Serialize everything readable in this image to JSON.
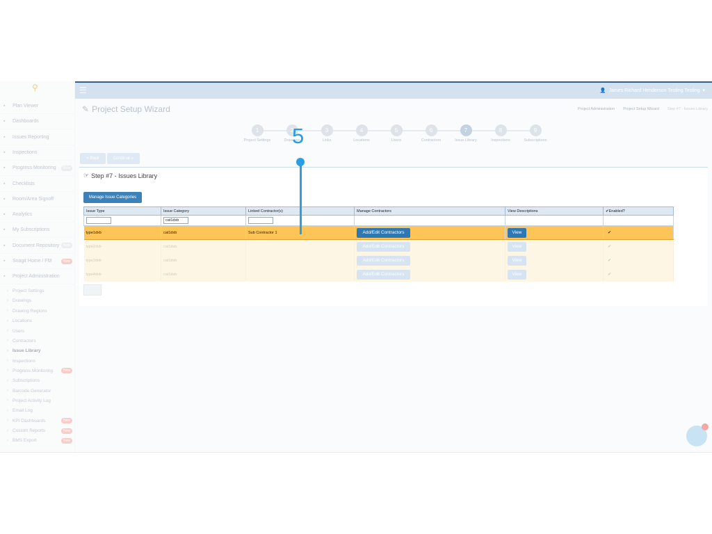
{
  "topbar": {
    "menu_icon": "hamburger-icon",
    "user_name": "James Richard Henderson Testing Testing"
  },
  "sidebar": {
    "items": [
      {
        "label": "Plan Viewer",
        "icon": "plan-icon",
        "badge": ""
      },
      {
        "label": "Dashboards",
        "icon": "dashboard-icon",
        "badge": ""
      },
      {
        "label": "Issues Reporting",
        "icon": "pin-icon",
        "badge": ""
      },
      {
        "label": "Inspections",
        "icon": "search-icon",
        "badge": ""
      },
      {
        "label": "Progress Monitoring",
        "icon": "chart-icon",
        "badge": "Beta"
      },
      {
        "label": "Checklists",
        "icon": "check-icon",
        "badge": ""
      },
      {
        "label": "Room/Area Signoff",
        "icon": "arrow-icon",
        "badge": ""
      },
      {
        "label": "Analytics",
        "icon": "analytics-icon",
        "badge": ""
      },
      {
        "label": "My Subscriptions",
        "icon": "subscription-icon",
        "badge": ""
      },
      {
        "label": "Document Repository",
        "icon": "document-icon",
        "badge": "Beta"
      },
      {
        "label": "Snagit Home / FM",
        "icon": "home-icon",
        "badge": "New"
      },
      {
        "label": "Project Administration",
        "icon": "gears-icon",
        "badge": ""
      }
    ],
    "sub_items": [
      {
        "label": "Project Settings",
        "badge": ""
      },
      {
        "label": "Drawings",
        "badge": ""
      },
      {
        "label": "Drawing Regions",
        "badge": ""
      },
      {
        "label": "Locations",
        "badge": ""
      },
      {
        "label": "Users",
        "badge": ""
      },
      {
        "label": "Contractors",
        "badge": ""
      },
      {
        "label": "Issue Library",
        "badge": ""
      },
      {
        "label": "Inspections",
        "badge": ""
      },
      {
        "label": "Progress Monitoring",
        "badge": "New"
      },
      {
        "label": "Subscriptions",
        "badge": ""
      },
      {
        "label": "Barcode Generator",
        "badge": ""
      },
      {
        "label": "Project Activity Log",
        "badge": ""
      },
      {
        "label": "Email Log",
        "badge": ""
      },
      {
        "label": "KPI Dashboards",
        "badge": "New"
      },
      {
        "label": "Custom Reports",
        "badge": "New"
      },
      {
        "label": "BMS Export",
        "badge": "New"
      }
    ]
  },
  "page": {
    "title": "Project Setup Wizard",
    "breadcrumb": [
      "Project Administration",
      "Project Setup Wizard",
      "Step #7 - Issues Library"
    ]
  },
  "wizard": {
    "steps": [
      {
        "num": "1",
        "label": "Project Settings"
      },
      {
        "num": "2",
        "label": "Drawings"
      },
      {
        "num": "3",
        "label": "Links"
      },
      {
        "num": "4",
        "label": "Locations"
      },
      {
        "num": "5",
        "label": "Users"
      },
      {
        "num": "6",
        "label": "Contractors"
      },
      {
        "num": "7",
        "label": "Issue Library"
      },
      {
        "num": "8",
        "label": "Inspections"
      },
      {
        "num": "9",
        "label": "Subscriptions"
      }
    ],
    "back_label": "Back",
    "continue_label": "Continue"
  },
  "panel": {
    "title": "Step #7 - Issues Library",
    "manage_button": "Manage Issue Categories",
    "columns": [
      "Issue Type",
      "Issue Category",
      "Linked Contractor(s)",
      "Manage Contractors",
      "View Descriptions",
      "Enabled?"
    ],
    "filters": {
      "issue_type": "",
      "issue_category": "cat1dxb",
      "linked": ""
    },
    "rows": [
      {
        "type": "type1dxb",
        "category": "cat1dxb",
        "contractor": "Sub Contractor 1",
        "action": "Add/Edit Contractors",
        "view": "View",
        "enabled": "✔"
      },
      {
        "type": "type2dxb",
        "category": "cat1dxb",
        "contractor": "",
        "action": "Add/Edit Contractors",
        "view": "View",
        "enabled": "✔"
      },
      {
        "type": "type3dxb",
        "category": "cat1dxb",
        "contractor": "",
        "action": "Add/Edit Contractors",
        "view": "View",
        "enabled": "✔"
      },
      {
        "type": "type4dxb",
        "category": "cat1dxb",
        "contractor": "",
        "action": "Add/Edit Contractors",
        "view": "View",
        "enabled": "✔"
      }
    ]
  },
  "annotation": {
    "label": "5",
    "color": "#2a9ee2"
  }
}
